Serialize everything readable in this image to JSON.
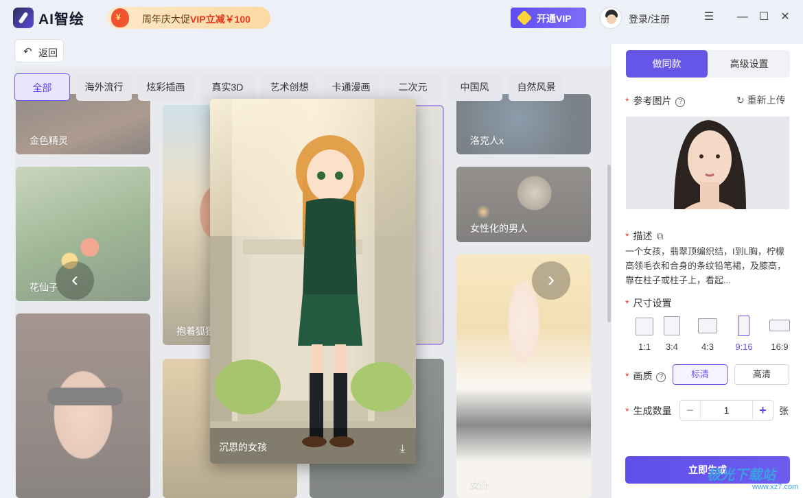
{
  "app": {
    "name": "AI智绘"
  },
  "promo": {
    "prefix": "周年庆大促",
    "highlight": "VIP立减￥100"
  },
  "header": {
    "vip_label": "开通VIP",
    "login_label": "登录/注册"
  },
  "nav": {
    "back_label": "返回"
  },
  "filters": [
    "全部",
    "海外流行",
    "炫彩插画",
    "真实3D",
    "艺术创想",
    "卡通漫画",
    "二次元",
    "中国风",
    "自然风景"
  ],
  "active_filter": "全部",
  "cards": {
    "c1": "金色精灵",
    "c2": "花仙子",
    "c3": "抱着狐狸",
    "c4": "洛克人x",
    "c5": "女性化的男人",
    "c6": "女仆"
  },
  "featured": {
    "title": "沉思的女孩"
  },
  "panel": {
    "tab_same": "做同款",
    "tab_advanced": "高级设置",
    "ref_label": "参考图片",
    "reupload": "重新上传",
    "desc_label": "描述",
    "desc_text": "一个女孩，翡翠顶编织结，I到L胸，柠檬高领毛衣和合身的条纹铅笔裙，及膝高，靠在柱子或柱子上，看起...",
    "size_label": "尺寸设置",
    "ratios": [
      "1:1",
      "3:4",
      "4:3",
      "9:16",
      "16:9"
    ],
    "selected_ratio": "9:16",
    "quality_label": "画质",
    "quality_options": [
      "标清",
      "高清"
    ],
    "selected_quality": "标清",
    "count_label": "生成数量",
    "count_value": "1",
    "count_unit": "张",
    "generate_label": "立即生成"
  },
  "watermark": {
    "text": "极光下载站",
    "url": "www.xz7.com"
  },
  "colors": {
    "accent": "#6556e8",
    "vip": "#6a57ef",
    "promo_red": "#e4361b"
  }
}
